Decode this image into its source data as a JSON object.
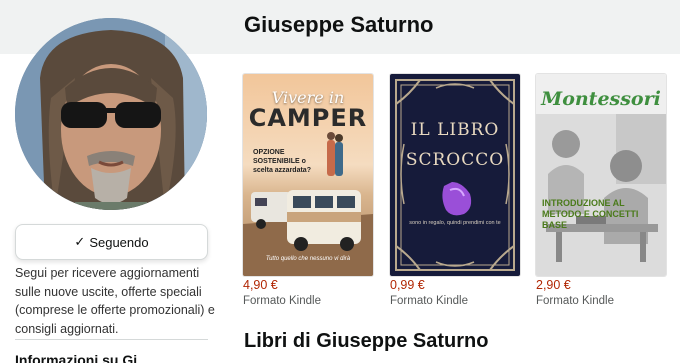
{
  "author": {
    "name": "Giuseppe Saturno"
  },
  "follow": {
    "check_glyph": "✓",
    "button_label": "Seguendo",
    "description": "Segui per ricevere aggiornamenti sulle nuove uscite, offerte speciali (comprese le offerte promozionali) e consigli aggiornati."
  },
  "info_heading_partial": "Informazioni su Gi",
  "books": [
    {
      "cover": {
        "title_line1": "Vivere in",
        "title_line2": "CAMPER",
        "subtitle": "OPZIONE SOSTENIBILE o scelta azzardata?",
        "footer": "Tutto quello che nessuno vi dirà"
      },
      "price": "4,90 €",
      "format": "Formato Kindle"
    },
    {
      "cover": {
        "title_line1": "IL LIBRO",
        "title_line2": "SCROCCO",
        "subtitle": "sono in regalo, quindi prendimi con te"
      },
      "price": "0,99 €",
      "format": "Formato Kindle"
    },
    {
      "cover": {
        "title": "Montessori",
        "subtitle": "INTRODUZIONE AL METODO E CONCETTI BASE"
      },
      "price": "2,90 €",
      "format": "Formato Kindle"
    }
  ],
  "section_heading": "Libri di Giuseppe Saturno",
  "colors": {
    "header_band": "#f0f2f2",
    "price": "#b12704",
    "format_text": "#565959",
    "button_border": "#d5d9d9"
  }
}
